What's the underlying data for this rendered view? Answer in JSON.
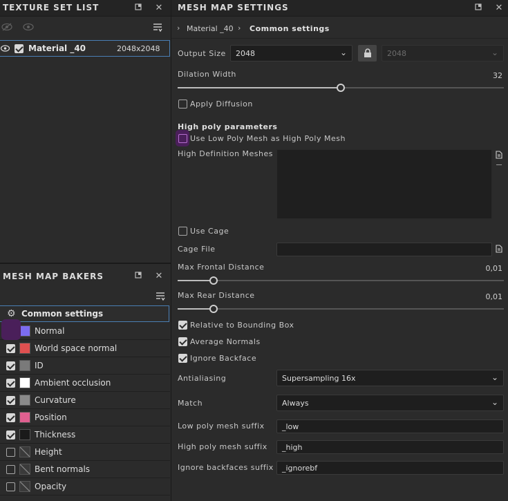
{
  "texture_set_list": {
    "title": "TEXTURE SET LIST",
    "material": {
      "name": "Material _40",
      "size": "2048x2048",
      "visible": true,
      "checked": true
    }
  },
  "mesh_map_bakers": {
    "title": "MESH MAP BAKERS",
    "common_settings_label": "Common settings",
    "items": [
      {
        "label": "Normal",
        "checked": false,
        "thumb_color": "#7b6cf0"
      },
      {
        "label": "World space normal",
        "checked": true,
        "thumb_color": "#e05050"
      },
      {
        "label": "ID",
        "checked": true,
        "thumb_color": "#7a7a7a"
      },
      {
        "label": "Ambient occlusion",
        "checked": true,
        "thumb_color": "#ffffff"
      },
      {
        "label": "Curvature",
        "checked": true,
        "thumb_color": "#8a8a8a"
      },
      {
        "label": "Position",
        "checked": true,
        "thumb_color": "#e06090"
      },
      {
        "label": "Thickness",
        "checked": true,
        "thumb_color": "#1a1a1a"
      },
      {
        "label": "Height",
        "checked": false,
        "thumb_color": "#3a3a3a"
      },
      {
        "label": "Bent normals",
        "checked": false,
        "thumb_color": "#3a3a3a"
      },
      {
        "label": "Opacity",
        "checked": false,
        "thumb_color": "#3a3a3a"
      }
    ]
  },
  "mesh_map_settings": {
    "title": "MESH MAP SETTINGS",
    "breadcrumb": {
      "material": "Material _40",
      "section": "Common settings"
    },
    "output_size": {
      "label": "Output Size",
      "value": "2048",
      "linked_value": "2048"
    },
    "dilation_width": {
      "label": "Dilation Width",
      "value": "32",
      "fraction": 0.5
    },
    "apply_diffusion": {
      "label": "Apply Diffusion",
      "checked": false
    },
    "high_poly_header": "High poly parameters",
    "use_low_poly": {
      "label": "Use Low Poly Mesh as High Poly Mesh",
      "checked": false
    },
    "hd_meshes_label": "High Definition Meshes",
    "use_cage": {
      "label": "Use Cage",
      "checked": false
    },
    "cage_file_label": "Cage File",
    "max_frontal": {
      "label": "Max Frontal Distance",
      "value": "0,01",
      "fraction": 0.11
    },
    "max_rear": {
      "label": "Max Rear Distance",
      "value": "0,01",
      "fraction": 0.11
    },
    "relative_bbox": {
      "label": "Relative to Bounding Box",
      "checked": true
    },
    "average_normals": {
      "label": "Average Normals",
      "checked": true
    },
    "ignore_backface": {
      "label": "Ignore Backface",
      "checked": true
    },
    "antialiasing": {
      "label": "Antialiasing",
      "value": "Supersampling 16x"
    },
    "match": {
      "label": "Match",
      "value": "Always"
    },
    "low_suffix": {
      "label": "Low poly mesh suffix",
      "value": "_low"
    },
    "high_suffix": {
      "label": "High poly mesh suffix",
      "value": "_high"
    },
    "ignore_suffix": {
      "label": "Ignore backfaces suffix",
      "value": "_ignorebf"
    }
  }
}
